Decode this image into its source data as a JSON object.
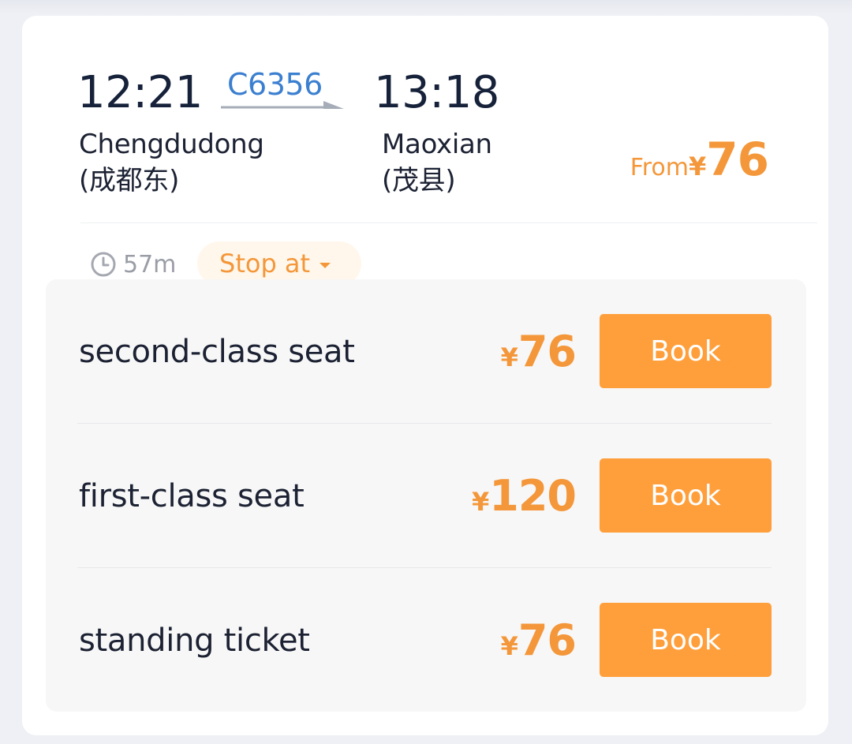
{
  "train": {
    "departure_time": "12:21",
    "arrival_time": "13:18",
    "number": "C6356",
    "departure_station": "Chengdudong",
    "departure_station_cn": "(成都东)",
    "arrival_station": "Maoxian",
    "arrival_station_cn": "(茂县)",
    "duration": "57m",
    "stop_at_label": "Stop at"
  },
  "from_price": {
    "label": "From",
    "currency": "¥",
    "value": "76"
  },
  "seats": [
    {
      "name": "second-class seat",
      "currency": "¥",
      "price": "76",
      "button": "Book"
    },
    {
      "name": "first-class seat",
      "currency": "¥",
      "price": "120",
      "button": "Book"
    },
    {
      "name": "standing ticket",
      "currency": "¥",
      "price": "76",
      "button": "Book"
    }
  ],
  "colors": {
    "accent": "#f4973a",
    "button": "#ff9f3b",
    "train_number": "#3b7fd0",
    "text_dark": "#16213a"
  },
  "icons": {
    "duration": "clock-icon",
    "stop_dropdown": "caret-down-icon",
    "route": "arrow-right-icon"
  }
}
